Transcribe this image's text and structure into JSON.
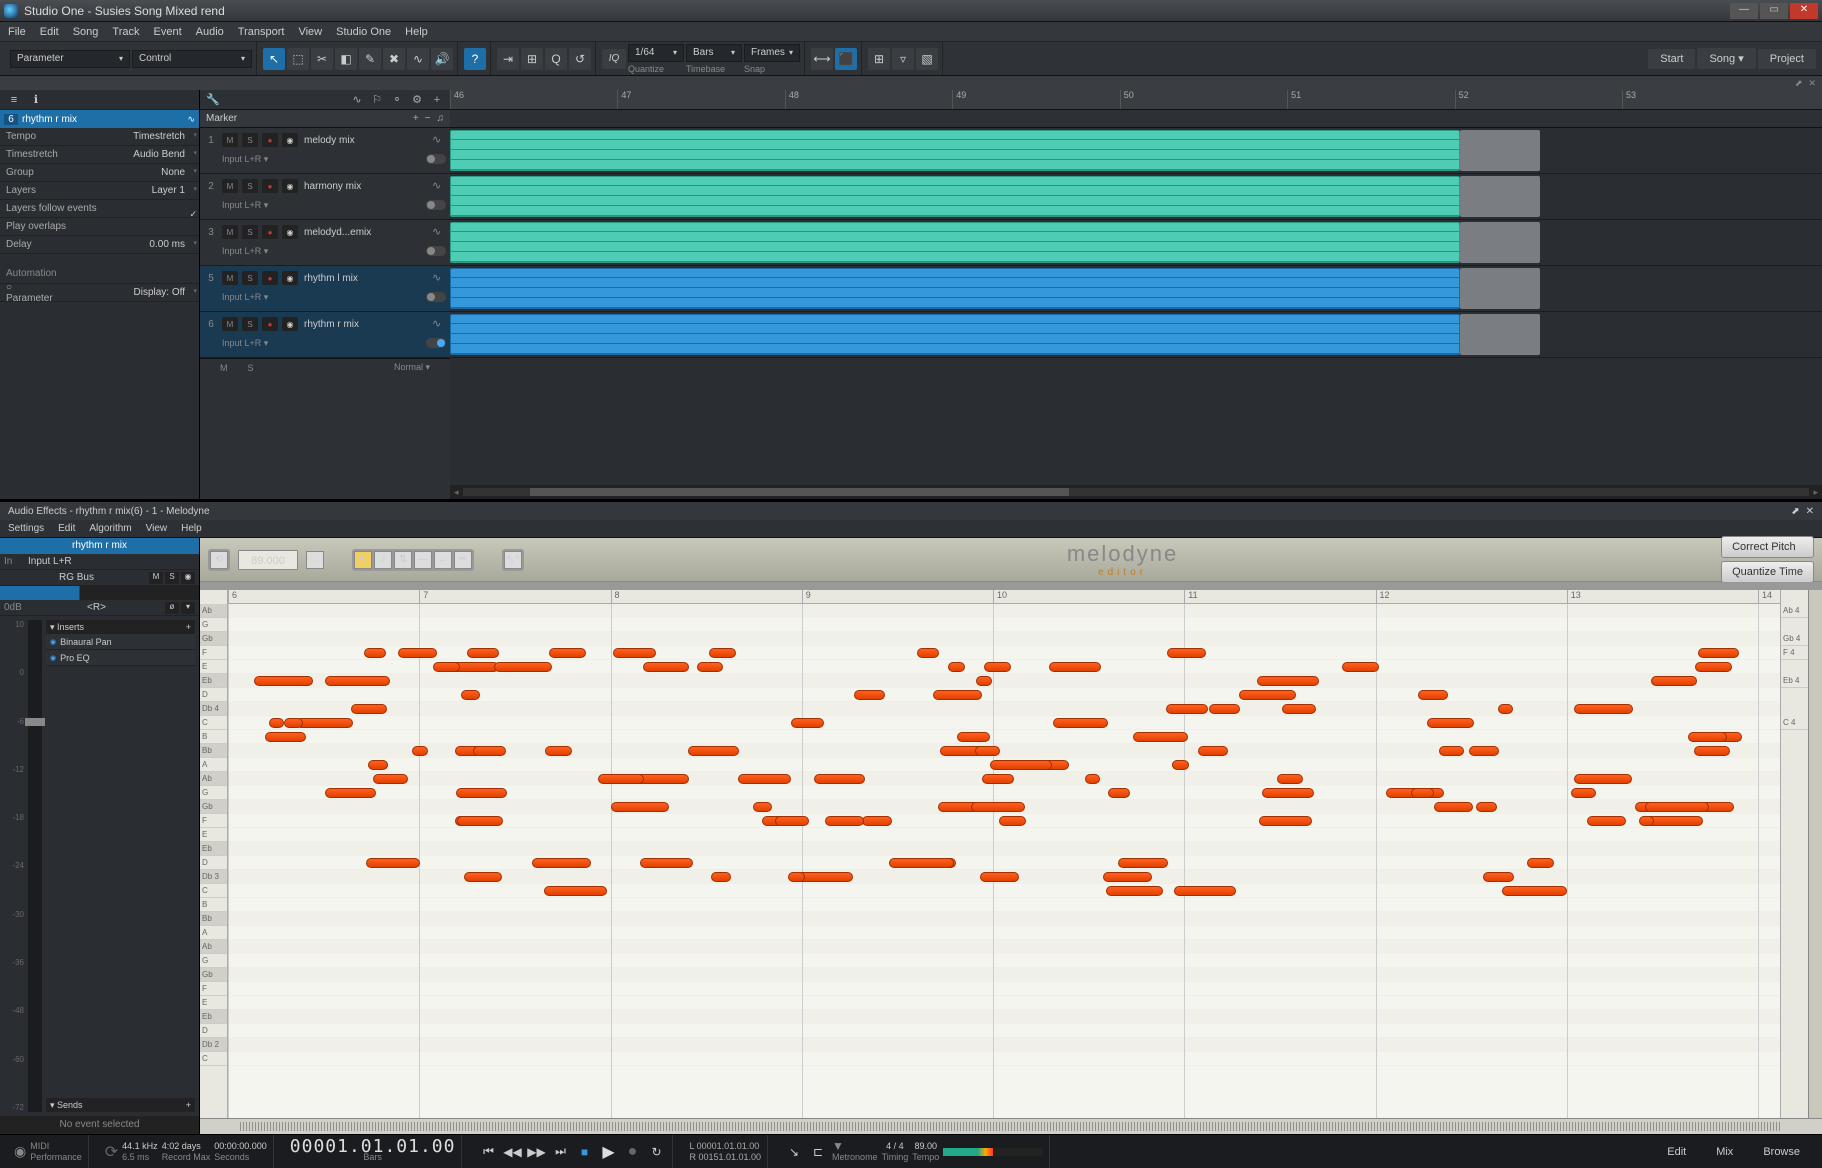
{
  "window": {
    "title": "Studio One - Susies Song Mixed rend"
  },
  "menu": [
    "File",
    "Edit",
    "Song",
    "Track",
    "Event",
    "Audio",
    "Transport",
    "View",
    "Studio One",
    "Help"
  ],
  "toolbar": {
    "parameter_label": "Parameter",
    "control_label": "Control",
    "quantize_val": "1/64",
    "quantize_label": "Quantize",
    "timebase_val": "Bars",
    "timebase_label": "Timebase",
    "snap_val": "Frames",
    "snap_label": "Snap",
    "iq": "IQ",
    "start": "Start",
    "song": "Song",
    "project": "Project"
  },
  "inspector": {
    "track_num": "6",
    "track_name": "rhythm r mix",
    "rows": [
      {
        "lbl": "Tempo",
        "val": "Timestretch"
      },
      {
        "lbl": "Timestretch",
        "val": "Audio Bend"
      },
      {
        "lbl": "Group",
        "val": "None"
      },
      {
        "lbl": "Layers",
        "val": "Layer 1"
      }
    ],
    "layers_follow": "Layers follow events",
    "play_overlaps": "Play overlaps",
    "delay_lbl": "Delay",
    "delay_val": "0.00 ms",
    "automation": "Automation",
    "param": "Parameter",
    "display": "Display: Off"
  },
  "tracklist": {
    "marker": "Marker",
    "tracks": [
      {
        "num": "1",
        "name": "melody mix",
        "input": "Input L+R",
        "color": "green"
      },
      {
        "num": "2",
        "name": "harmony mix",
        "input": "Input L+R",
        "color": "green"
      },
      {
        "num": "3",
        "name": "melodyd...emix",
        "input": "Input L+R",
        "color": "green"
      },
      {
        "num": "5",
        "name": "rhythm l mix",
        "input": "Input L+R",
        "color": "blue"
      },
      {
        "num": "6",
        "name": "rhythm r mix",
        "input": "Input L+R",
        "color": "blue",
        "sel": true
      }
    ],
    "foot_m": "M",
    "foot_s": "S",
    "foot_normal": "Normal"
  },
  "ruler_bars": [
    "46",
    "47",
    "48",
    "49",
    "50",
    "51",
    "52",
    "53"
  ],
  "fx": {
    "title": "Audio Effects - rhythm r mix(6) - 1 - Melodyne",
    "menu": [
      "Settings",
      "Edit",
      "Algorithm",
      "View",
      "Help"
    ]
  },
  "mixer": {
    "name": "rhythm r mix",
    "in_lbl": "In",
    "in_val": "Input L+R",
    "bus": "RG Bus",
    "db_lbl": "0dB",
    "r_lbl": "<R>",
    "scale": [
      "10",
      "0",
      "-6",
      "-12",
      "-18",
      "-24",
      "-30",
      "-36",
      "-48",
      "-60",
      "-72"
    ],
    "inserts_hdr": "Inserts",
    "inserts": [
      "Binaural Pan",
      "Pro EQ"
    ],
    "sends_hdr": "Sends",
    "no_event": "No event selected"
  },
  "melodyne": {
    "tempo": "89.000",
    "logo": "melodyne",
    "logo_sub": "editor",
    "correct_pitch": "Correct Pitch",
    "quantize_time": "Quantize Time",
    "ruler": [
      "6",
      "7",
      "8",
      "9",
      "10",
      "11",
      "12",
      "13",
      "14"
    ],
    "keys": [
      "Ab",
      "G",
      "Gb",
      "F",
      "E",
      "Eb",
      "D",
      "Db 4",
      "C",
      "B",
      "Bb",
      "A",
      "Ab",
      "G",
      "Gb",
      "F",
      "E",
      "Eb",
      "D",
      "Db 3",
      "C",
      "B",
      "Bb",
      "A",
      "Ab",
      "G",
      "Gb",
      "F",
      "E",
      "Eb",
      "D",
      "Db 2",
      "C"
    ],
    "right_labels": [
      "Ab 4",
      "Gb 4",
      "F 4",
      "Eb 4",
      "C 4"
    ]
  },
  "transport": {
    "midi": "MIDI",
    "perf": "Performance",
    "sr": "44.1 kHz",
    "lat": "6.5 ms",
    "dur": "4:02 days",
    "rec": "Record Max",
    "rectime": "00:00:00.000",
    "sec": "Seconds",
    "time": "00001.01.01.00",
    "bars": "Bars",
    "loc_l": "L  00001.01.01.00",
    "loc_r": "R  00151.01.01.00",
    "metro": "Metronome",
    "sig": "4 / 4",
    "timing": "Timing",
    "tempo": "89.00",
    "tempo_lbl": "Tempo",
    "edit": "Edit",
    "mix": "Mix",
    "browse": "Browse"
  }
}
